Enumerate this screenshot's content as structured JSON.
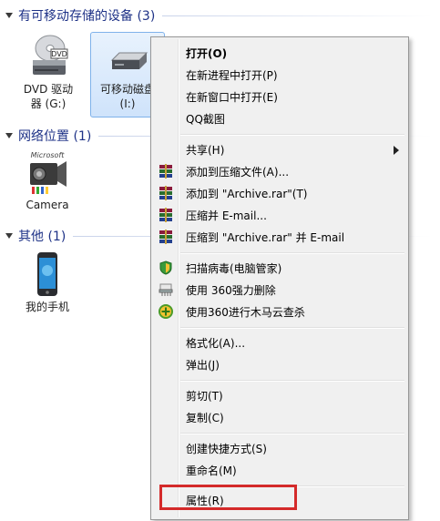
{
  "groups": {
    "removable": {
      "title": "有可移动存储的设备 (3)",
      "items": [
        {
          "label1": "DVD 驱动",
          "label2": "器 (G:)",
          "icon": "dvd-drive-icon",
          "badge": "DVD"
        },
        {
          "label1": "可移动磁盘",
          "label2": "(I:)",
          "icon": "removable-disk-icon"
        }
      ]
    },
    "network": {
      "title": "网络位置 (1)",
      "items": [
        {
          "label": "Camera",
          "icon": "camera-icon",
          "brand": "Microsoft"
        }
      ]
    },
    "other": {
      "title": "其他 (1)",
      "items": [
        {
          "label": "我的手机",
          "icon": "phone-icon"
        }
      ]
    }
  },
  "menu": {
    "items": [
      {
        "label": "打开(O)",
        "bold": true
      },
      {
        "label": "在新进程中打开(P)"
      },
      {
        "label": "在新窗口中打开(E)"
      },
      {
        "label": "QQ截图"
      },
      {
        "label": "共享(H)",
        "submenu": true
      },
      {
        "label": "添加到压缩文件(A)...",
        "icon": "winrar-icon"
      },
      {
        "label": "添加到 \"Archive.rar\"(T)",
        "icon": "winrar-icon"
      },
      {
        "label": "压缩并 E-mail...",
        "icon": "winrar-icon"
      },
      {
        "label": "压缩到 \"Archive.rar\" 并 E-mail",
        "icon": "winrar-icon"
      },
      {
        "label": "扫描病毒(电脑管家)",
        "icon": "shield-icon"
      },
      {
        "label": "使用 360强力删除",
        "icon": "shredder-icon"
      },
      {
        "label": "使用360进行木马云查杀",
        "icon": "plus-green-icon"
      },
      {
        "label": "格式化(A)..."
      },
      {
        "label": "弹出(J)"
      },
      {
        "label": "剪切(T)"
      },
      {
        "label": "复制(C)"
      },
      {
        "label": "创建快捷方式(S)"
      },
      {
        "label": "重命名(M)"
      },
      {
        "label": "属性(R)"
      }
    ]
  },
  "colors": {
    "group_title": "#1e3287",
    "highlight_box": "#d42a2a",
    "menu_bg": "#f0f0f0"
  }
}
